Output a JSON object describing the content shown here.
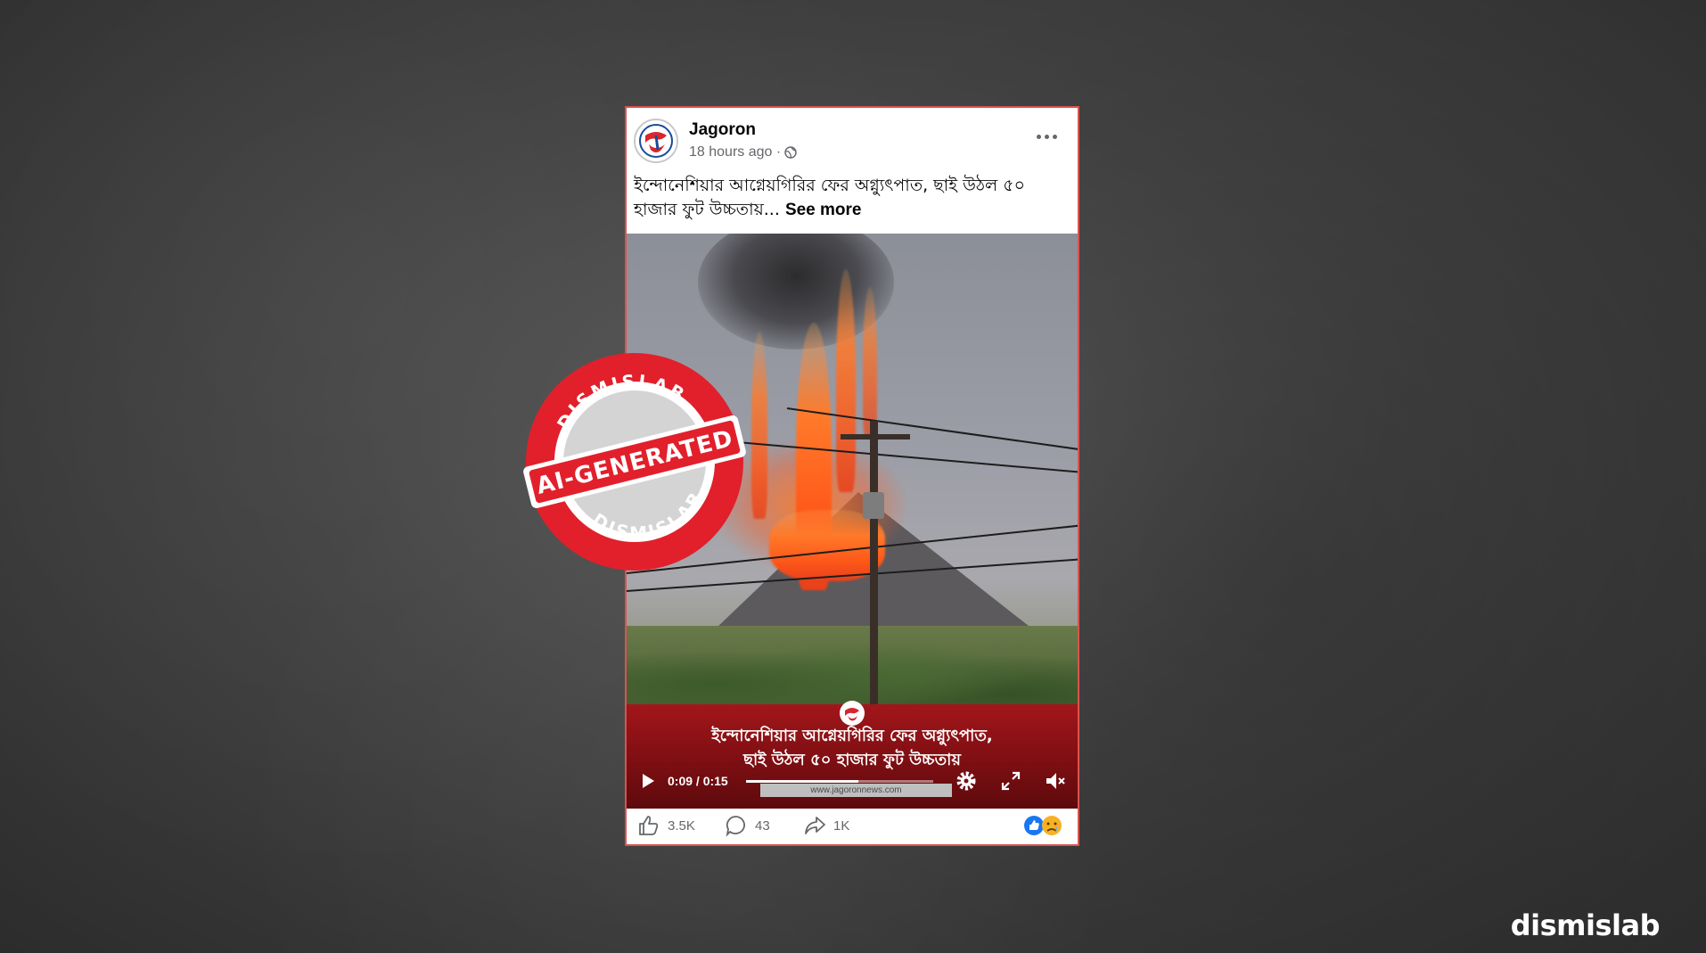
{
  "post": {
    "page_name": "Jagoron",
    "time": "18 hours ago · ",
    "caption": "ইন্দোনেশিয়ার আগ্নেয়গিরির ফের অগ্ন্যুৎপাত, ছাই উঠল ৫০ হাজার ফুট উচ্চতায়... ",
    "see_more": "See more"
  },
  "video": {
    "banner_line1": "ইন্দোনেশিয়ার আগ্নেয়গিরির ফের অগ্ন্যুৎপাত,",
    "banner_line2": "ছাই উঠল ৫০ হাজার ফুট উচ্চতায়",
    "site_url": "www.jagoronnews.com",
    "time_display": "0:09 / 0:15",
    "progress_fraction": 0.6
  },
  "reactions": {
    "likes": "3.5K",
    "comments": "43",
    "shares": "1K"
  },
  "stamp": {
    "top_text": "DISMISLAB",
    "band_text": "AI-GENERATED",
    "bottom_text": "DISMISLAB"
  },
  "brand": "dismislab",
  "colors": {
    "stamp_red": "#e1202b",
    "banner_red": "#a2161a",
    "facebook_blue": "#1877f2"
  }
}
